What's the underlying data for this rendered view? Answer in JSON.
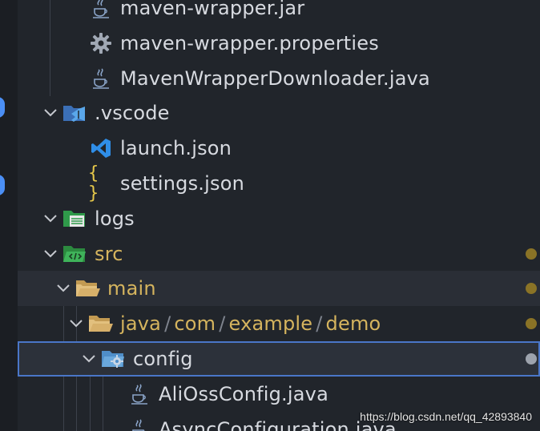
{
  "tree": {
    "items": [
      {
        "label": "maven-wrapper.jar",
        "icon": "java-icon"
      },
      {
        "label": "maven-wrapper.properties",
        "icon": "gear-icon"
      },
      {
        "label": "MavenWrapperDownloader.java",
        "icon": "java-icon"
      },
      {
        "label": ".vscode",
        "icon": "vscode-folder-icon",
        "expanded": true
      },
      {
        "label": "launch.json",
        "icon": "vscode-icon"
      },
      {
        "label": "settings.json",
        "icon": "json-braces-icon",
        "icon_text": "{ }"
      },
      {
        "label": "logs",
        "icon": "logs-folder-icon",
        "expanded": true
      },
      {
        "label": "src",
        "icon": "src-folder-icon",
        "expanded": true
      },
      {
        "label": "main",
        "icon": "folder-open-icon",
        "expanded": true
      },
      {
        "path": [
          "java",
          "com",
          "example",
          "demo"
        ],
        "separator": "/",
        "icon": "folder-open-icon",
        "expanded": true
      },
      {
        "label": "config",
        "icon": "config-folder-icon",
        "expanded": true,
        "selected": true
      },
      {
        "label": "AliOssConfig.java",
        "icon": "java-icon"
      },
      {
        "label": "AsyncConfiguration.java",
        "icon": "java-icon"
      }
    ]
  },
  "colors": {
    "background": "#21252b",
    "text": "#d7dae0",
    "git_modified_text": "#d5b45e",
    "git_modified_dot": "#8a7326",
    "selected_dot": "#9da3ad",
    "selection_border": "#4a76c8",
    "accent_badge": "#4b8ff5"
  },
  "watermark": "https://blog.csdn.net/qq_42893840"
}
